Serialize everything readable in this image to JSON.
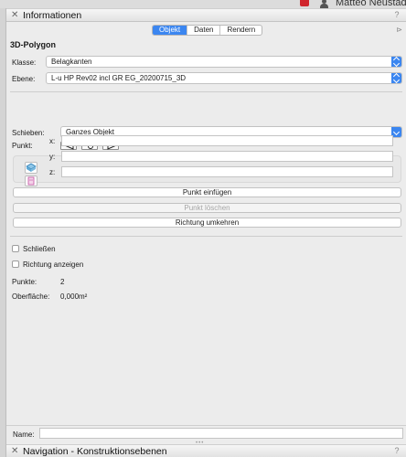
{
  "topbar": {
    "flag_icon": "red-flag-icon",
    "user_icon": "person-icon",
    "user_name": "Matteo Neustad"
  },
  "info_panel": {
    "title": "Informationen",
    "help": "?",
    "tabs": [
      {
        "label": "Objekt",
        "active": true
      },
      {
        "label": "Daten",
        "active": false
      },
      {
        "label": "Rendern",
        "active": false
      }
    ],
    "object_type": "3D-Polygon",
    "klasse": {
      "label": "Klasse:",
      "value": "Belagkanten"
    },
    "ebene": {
      "label": "Ebene:",
      "value": "L-u HP Rev02 incl GR EG_20200715_3D"
    },
    "schieben": {
      "label": "Schieben:",
      "value": "Ganzes Objekt"
    },
    "punkt_label": "Punkt:",
    "coords": {
      "x_label": "x:",
      "y_label": "y:",
      "z_label": "z:",
      "x": "",
      "y": "",
      "z": ""
    },
    "buttons": {
      "insert": "Punkt einfügen",
      "delete": "Punkt löschen",
      "reverse": "Richtung umkehren"
    },
    "checks": {
      "close": {
        "label": "Schließen",
        "checked": false
      },
      "show_direction": {
        "label": "Richtung anzeigen",
        "checked": false
      }
    },
    "stats": {
      "points_label": "Punkte:",
      "points_value": "2",
      "surface_label": "Oberfläche:",
      "surface_value": "0,000m²"
    },
    "name": {
      "label": "Name:",
      "value": ""
    }
  },
  "nav_panel": {
    "title": "Navigation - Konstruktionsebenen",
    "help": "?"
  },
  "colors": {
    "accent": "#3b86f0",
    "flag": "#d0262d"
  }
}
